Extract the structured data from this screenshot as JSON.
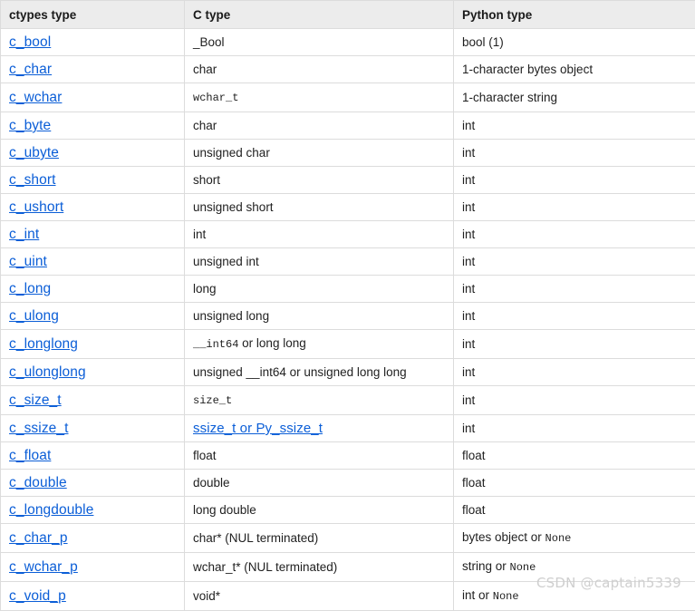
{
  "table": {
    "columns": [
      {
        "key": "ctypes_type",
        "label": "ctypes type"
      },
      {
        "key": "c_type",
        "label": "C type"
      },
      {
        "key": "python_type",
        "label": "Python type"
      }
    ],
    "rows": [
      {
        "ctypes_type": "c_bool",
        "c_type": "_Bool",
        "c_type_style": "plain",
        "python_type": "bool (1)",
        "python_type_style": "plain"
      },
      {
        "ctypes_type": "c_char",
        "c_type": "char",
        "c_type_style": "plain",
        "python_type": "1-character bytes object",
        "python_type_style": "plain"
      },
      {
        "ctypes_type": "c_wchar",
        "c_type": "wchar_t",
        "c_type_style": "mono",
        "python_type": "1-character string",
        "python_type_style": "plain"
      },
      {
        "ctypes_type": "c_byte",
        "c_type": "char",
        "c_type_style": "plain",
        "python_type": "int",
        "python_type_style": "plain"
      },
      {
        "ctypes_type": "c_ubyte",
        "c_type": "unsigned char",
        "c_type_style": "plain",
        "python_type": "int",
        "python_type_style": "plain"
      },
      {
        "ctypes_type": "c_short",
        "c_type": "short",
        "c_type_style": "plain",
        "python_type": "int",
        "python_type_style": "plain"
      },
      {
        "ctypes_type": "c_ushort",
        "c_type": "unsigned short",
        "c_type_style": "plain",
        "python_type": "int",
        "python_type_style": "plain"
      },
      {
        "ctypes_type": "c_int",
        "c_type": "int",
        "c_type_style": "plain",
        "python_type": "int",
        "python_type_style": "plain"
      },
      {
        "ctypes_type": "c_uint",
        "c_type": "unsigned int",
        "c_type_style": "plain",
        "python_type": "int",
        "python_type_style": "plain"
      },
      {
        "ctypes_type": "c_long",
        "c_type": "long",
        "c_type_style": "plain",
        "python_type": "int",
        "python_type_style": "plain"
      },
      {
        "ctypes_type": "c_ulong",
        "c_type": "unsigned long",
        "c_type_style": "plain",
        "python_type": "int",
        "python_type_style": "plain"
      },
      {
        "ctypes_type": "c_longlong",
        "c_type": "__int64 or long long",
        "c_type_style": "mono-prefix",
        "c_type_mono_part": "__int64",
        "c_type_plain_part": " or long long",
        "python_type": "int",
        "python_type_style": "plain"
      },
      {
        "ctypes_type": "c_ulonglong",
        "c_type": "unsigned __int64 or unsigned long long",
        "c_type_style": "plain",
        "python_type": "int",
        "python_type_style": "plain"
      },
      {
        "ctypes_type": "c_size_t",
        "c_type": "size_t",
        "c_type_style": "mono",
        "python_type": "int",
        "python_type_style": "plain"
      },
      {
        "ctypes_type": "c_ssize_t",
        "c_type": "ssize_t or Py_ssize_t",
        "c_type_style": "link",
        "python_type": "int",
        "python_type_style": "plain"
      },
      {
        "ctypes_type": "c_float",
        "c_type": "float",
        "c_type_style": "plain",
        "python_type": "float",
        "python_type_style": "plain"
      },
      {
        "ctypes_type": "c_double",
        "c_type": "double",
        "c_type_style": "plain",
        "python_type": "float",
        "python_type_style": "plain"
      },
      {
        "ctypes_type": "c_longdouble",
        "c_type": "long double",
        "c_type_style": "plain",
        "python_type": "float",
        "python_type_style": "plain"
      },
      {
        "ctypes_type": "c_char_p",
        "c_type": "char* (NUL terminated)",
        "c_type_style": "plain",
        "python_type": "bytes object or None",
        "python_type_style": "mono-suffix",
        "python_type_plain_part": "bytes object or ",
        "python_type_mono_part": "None"
      },
      {
        "ctypes_type": "c_wchar_p",
        "c_type": "wchar_t* (NUL terminated)",
        "c_type_style": "plain",
        "python_type": "string or None",
        "python_type_style": "mono-suffix",
        "python_type_plain_part": "string or ",
        "python_type_mono_part": "None"
      },
      {
        "ctypes_type": "c_void_p",
        "c_type": "void*",
        "c_type_style": "plain",
        "python_type": "int or None",
        "python_type_style": "mono-suffix",
        "python_type_plain_part": "int or ",
        "python_type_mono_part": "None"
      }
    ]
  },
  "watermark": {
    "text": "CSDN @captain5339"
  },
  "colors": {
    "link": "#0b5ed7",
    "header_bg": "#ececec",
    "border": "#dcdcdc",
    "text": "#1f1f1f",
    "watermark": "#cfcfcf"
  }
}
